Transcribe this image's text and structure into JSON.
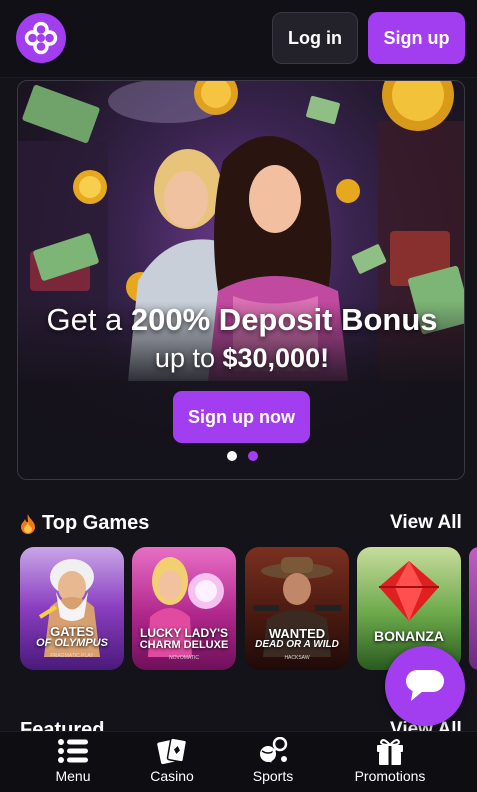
{
  "header": {
    "login_label": "Log in",
    "signup_label": "Sign up"
  },
  "banner": {
    "line1_prefix": "Get a ",
    "line1_bold": "200% Deposit Bonus",
    "line2_prefix": "up to ",
    "line2_bold": "$30,000!",
    "cta_label": "Sign up now",
    "slide_count": 2,
    "active_slide": 2
  },
  "top_games": {
    "title": "Top Games",
    "view_all": "View All",
    "games": [
      {
        "name_line1": "GATES",
        "name_line2": "OF OLYMPUS",
        "provider": "PRAGMATIC PLAY"
      },
      {
        "name_line1": "LUCKY LADY'S",
        "name_line2": "CHARM DELUXE",
        "provider": "NOVOMATIC"
      },
      {
        "name_line1": "WANTED",
        "name_line2": "DEAD OR A WILD",
        "provider": "HACKSAW"
      },
      {
        "name_line1": "BONANZA",
        "name_line2": "",
        "provider": ""
      }
    ]
  },
  "featured": {
    "title": "Featured",
    "view_all": "View All"
  },
  "bottom_nav": {
    "items": [
      {
        "label": "Menu",
        "icon": "menu-icon"
      },
      {
        "label": "Casino",
        "icon": "cards-icon"
      },
      {
        "label": "Sports",
        "icon": "sports-icon"
      },
      {
        "label": "Promotions",
        "icon": "gift-icon"
      }
    ]
  },
  "colors": {
    "accent": "#a23df0",
    "background": "#14131a",
    "header_bg": "#101016"
  }
}
